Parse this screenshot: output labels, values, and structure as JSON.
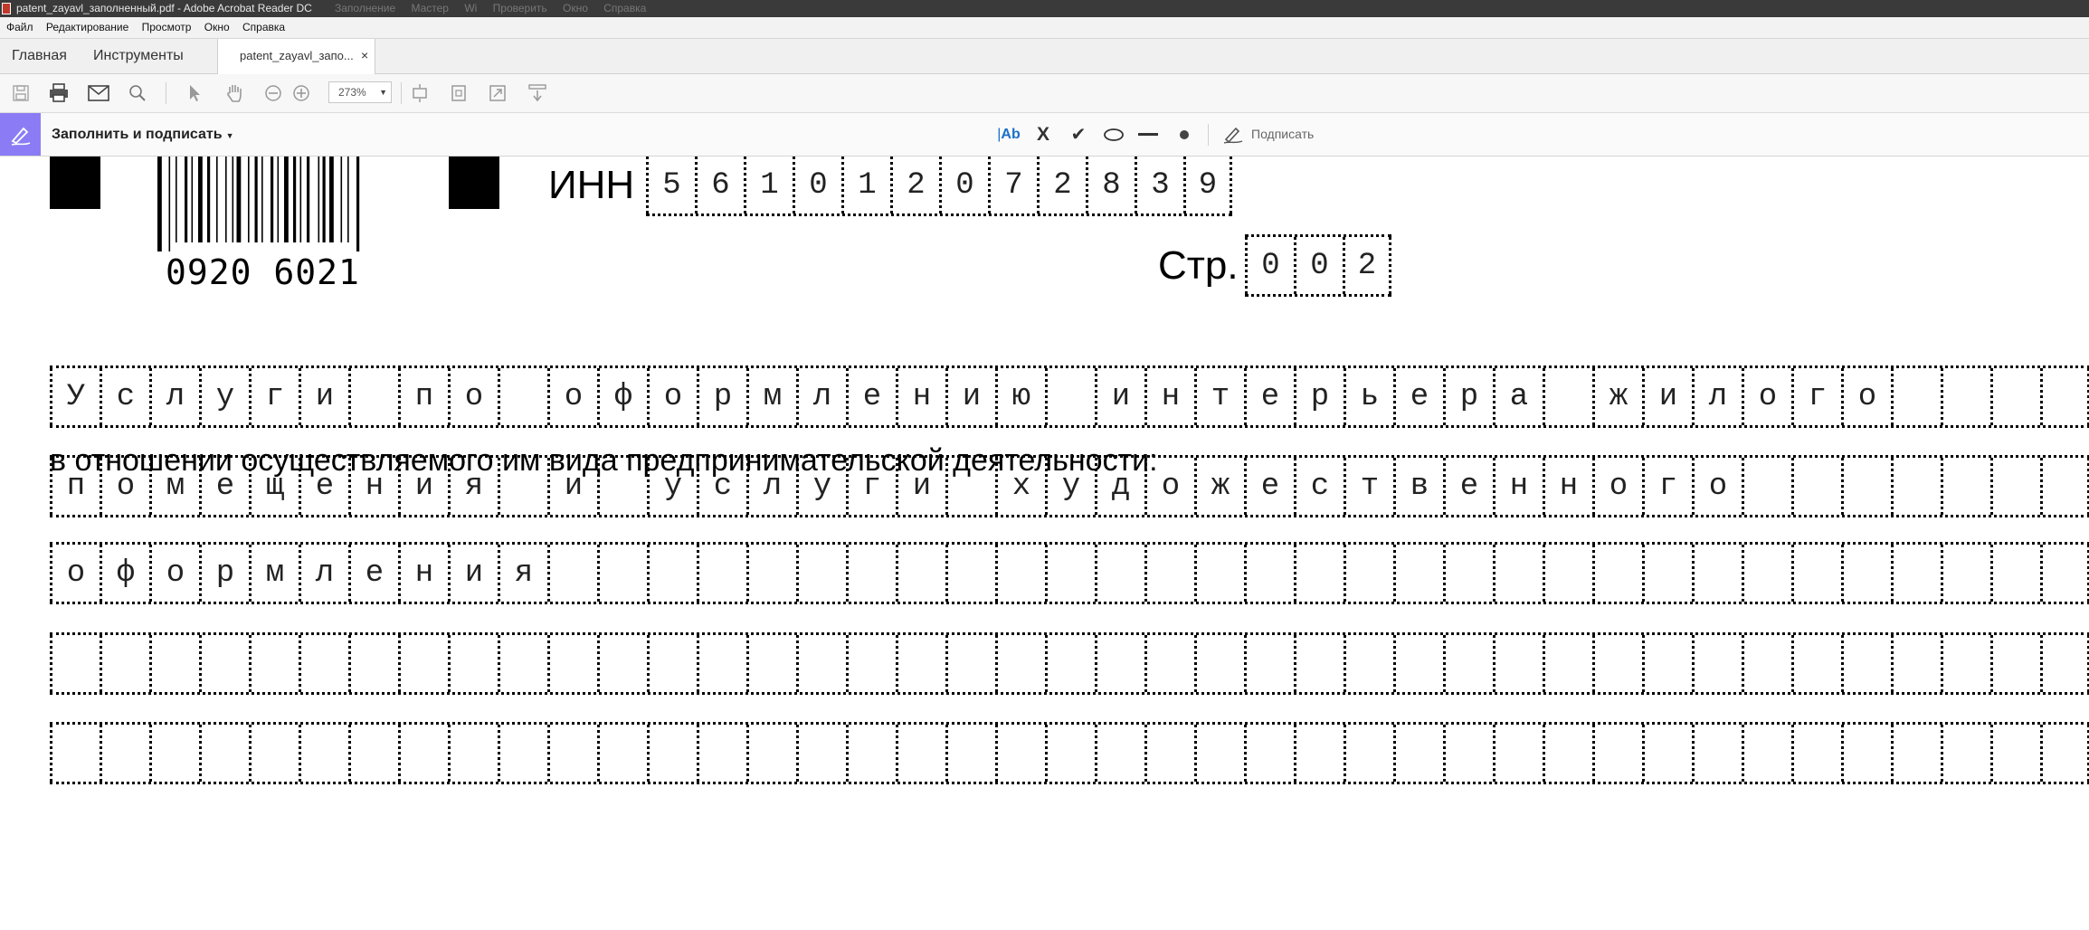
{
  "window": {
    "title": "patent_zayavl_заполненный.pdf - Adobe Acrobat Reader DC",
    "ghost_title": "Заполнение  Мастер  Wi  Проверить  Окно  Справка"
  },
  "menu": [
    "Файл",
    "Редактирование",
    "Просмотр",
    "Окно",
    "Справка"
  ],
  "nav": {
    "home": "Главная",
    "tools": "Инструменты",
    "doc_tab": "patent_zayavl_запо...",
    "close": "×"
  },
  "toolbar": {
    "zoom": "273%"
  },
  "icons": [
    "save-icon",
    "print-icon",
    "email-icon",
    "search-icon",
    "select-arrow-icon",
    "hand-icon",
    "zoom-out-icon",
    "zoom-in-icon",
    "fit-page-icon",
    "rotate-icon",
    "fullscreen-icon",
    "scroll-icon"
  ],
  "fill_sign": {
    "title": "Заполнить и подписать",
    "text_tool": "Ab",
    "cross_tool": "X",
    "check_tool": "✔",
    "sign_label": "Подписать",
    "accent": "#8b7cf5"
  },
  "document": {
    "barcode_number": "0920 6021",
    "inn_label": "ИНН",
    "inn_digits": [
      "5",
      "6",
      "1",
      "0",
      "1",
      "2",
      "0",
      "7",
      "2",
      "8",
      "3",
      "9"
    ],
    "page_label": "Стр.",
    "page_digits": [
      "0",
      "0",
      "2"
    ],
    "activity_label": "в отношении осуществляемого им вида предпринимательской деятельности:",
    "activity_rows": [
      "Услуги по оформлению интерьера жилого",
      "помещения и услуги художественного",
      "оформления",
      "",
      ""
    ]
  }
}
